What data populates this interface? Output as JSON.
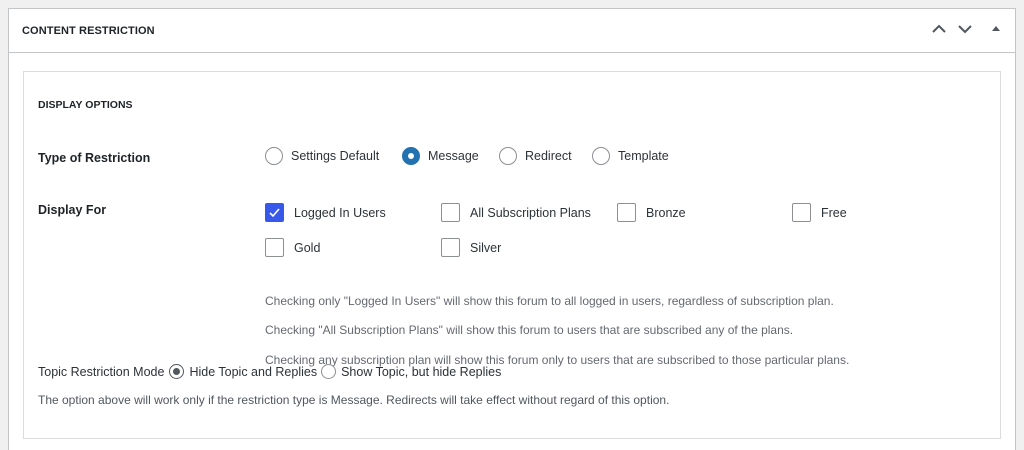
{
  "panel": {
    "title": "CONTENT RESTRICTION",
    "icons": [
      "chevron-up-icon",
      "chevron-down-icon",
      "triangle-up-icon"
    ]
  },
  "display_options": {
    "title": "DISPLAY OPTIONS",
    "type_of_restriction": {
      "label": "Type of Restriction",
      "options": [
        "Settings Default",
        "Message",
        "Redirect",
        "Template"
      ],
      "selected": "Message"
    },
    "display_for": {
      "label": "Display For",
      "options": [
        {
          "label": "Logged In Users",
          "checked": true
        },
        {
          "label": "All Subscription Plans",
          "checked": false
        },
        {
          "label": "Bronze",
          "checked": false
        },
        {
          "label": "Free",
          "checked": false
        },
        {
          "label": "Gold",
          "checked": false
        },
        {
          "label": "Silver",
          "checked": false
        }
      ]
    },
    "help": [
      "Checking only \"Logged In Users\" will show this forum to all logged in users, regardless of subscription plan.",
      "Checking \"All Subscription Plans\" will show this forum to users that are subscribed any of the plans.",
      "Checking any subscription plan will show this forum only to users that are subscribed to those particular plans."
    ],
    "topic_restriction": {
      "label": "Topic Restriction Mode",
      "options": [
        "Hide Topic and Replies",
        "Show Topic, but hide Replies"
      ],
      "selected": "Hide Topic and Replies"
    },
    "note": "The option above will work only if the restriction type is Message. Redirects will take effect without regard of this option."
  },
  "colors": {
    "accent": "#2271b1",
    "checkbox_accent": "#3858e9",
    "border": "#c3c4c7",
    "background": "#f0f0f1"
  }
}
